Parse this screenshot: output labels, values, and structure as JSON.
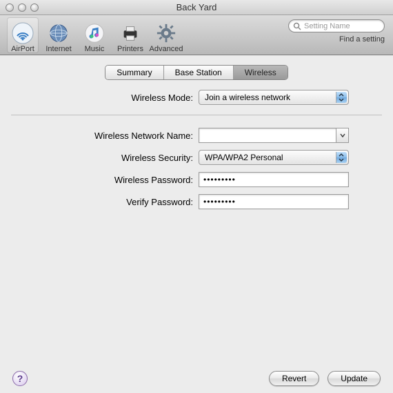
{
  "window": {
    "title": "Back Yard"
  },
  "toolbar": {
    "items": [
      {
        "label": "AirPort"
      },
      {
        "label": "Internet"
      },
      {
        "label": "Music"
      },
      {
        "label": "Printers"
      },
      {
        "label": "Advanced"
      }
    ],
    "selected_index": 0
  },
  "search": {
    "placeholder": "Setting Name",
    "find_label": "Find a setting"
  },
  "tabs": {
    "items": [
      "Summary",
      "Base Station",
      "Wireless"
    ],
    "active_index": 2
  },
  "form": {
    "wireless_mode": {
      "label": "Wireless Mode:",
      "value": "Join a wireless network"
    },
    "network_name": {
      "label": "Wireless Network Name:",
      "value": ""
    },
    "security": {
      "label": "Wireless Security:",
      "value": "WPA/WPA2 Personal"
    },
    "password": {
      "label": "Wireless Password:",
      "value": "•••••••••"
    },
    "verify": {
      "label": "Verify Password:",
      "value": "•••••••••"
    }
  },
  "footer": {
    "help": "?",
    "revert": "Revert",
    "update": "Update"
  }
}
